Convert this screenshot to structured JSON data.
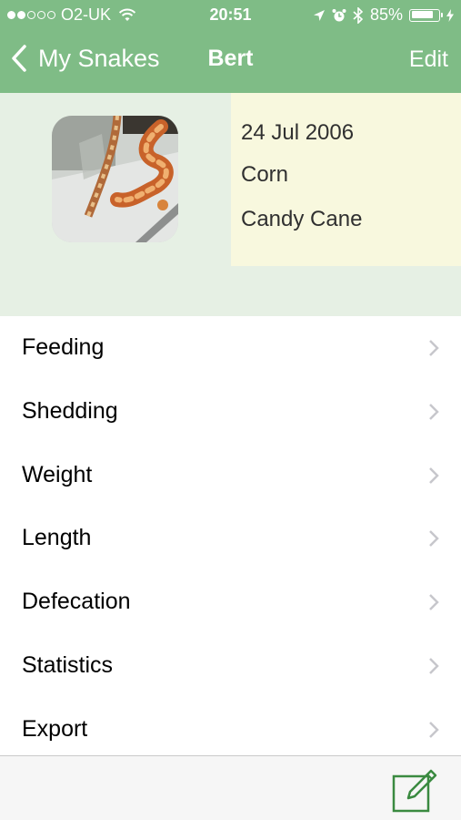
{
  "status_bar": {
    "carrier": "O2-UK",
    "time": "20:51",
    "battery_percent": "85%",
    "battery_level": 0.85,
    "signal_bars": 2,
    "signal_total": 5
  },
  "nav": {
    "back_label": "My Snakes",
    "title": "Bert",
    "edit_label": "Edit"
  },
  "profile": {
    "date": "24 Jul 2006",
    "species": "Corn",
    "morph": "Candy Cane"
  },
  "menu": {
    "items": [
      {
        "label": "Feeding"
      },
      {
        "label": "Shedding"
      },
      {
        "label": "Weight"
      },
      {
        "label": "Length"
      },
      {
        "label": "Defecation"
      },
      {
        "label": "Statistics"
      },
      {
        "label": "Export"
      }
    ]
  },
  "colors": {
    "header": "#7fbc86",
    "accent": "#3a8a40",
    "profile_bg": "#e6f0e4",
    "info_bg": "#f8f8de"
  }
}
